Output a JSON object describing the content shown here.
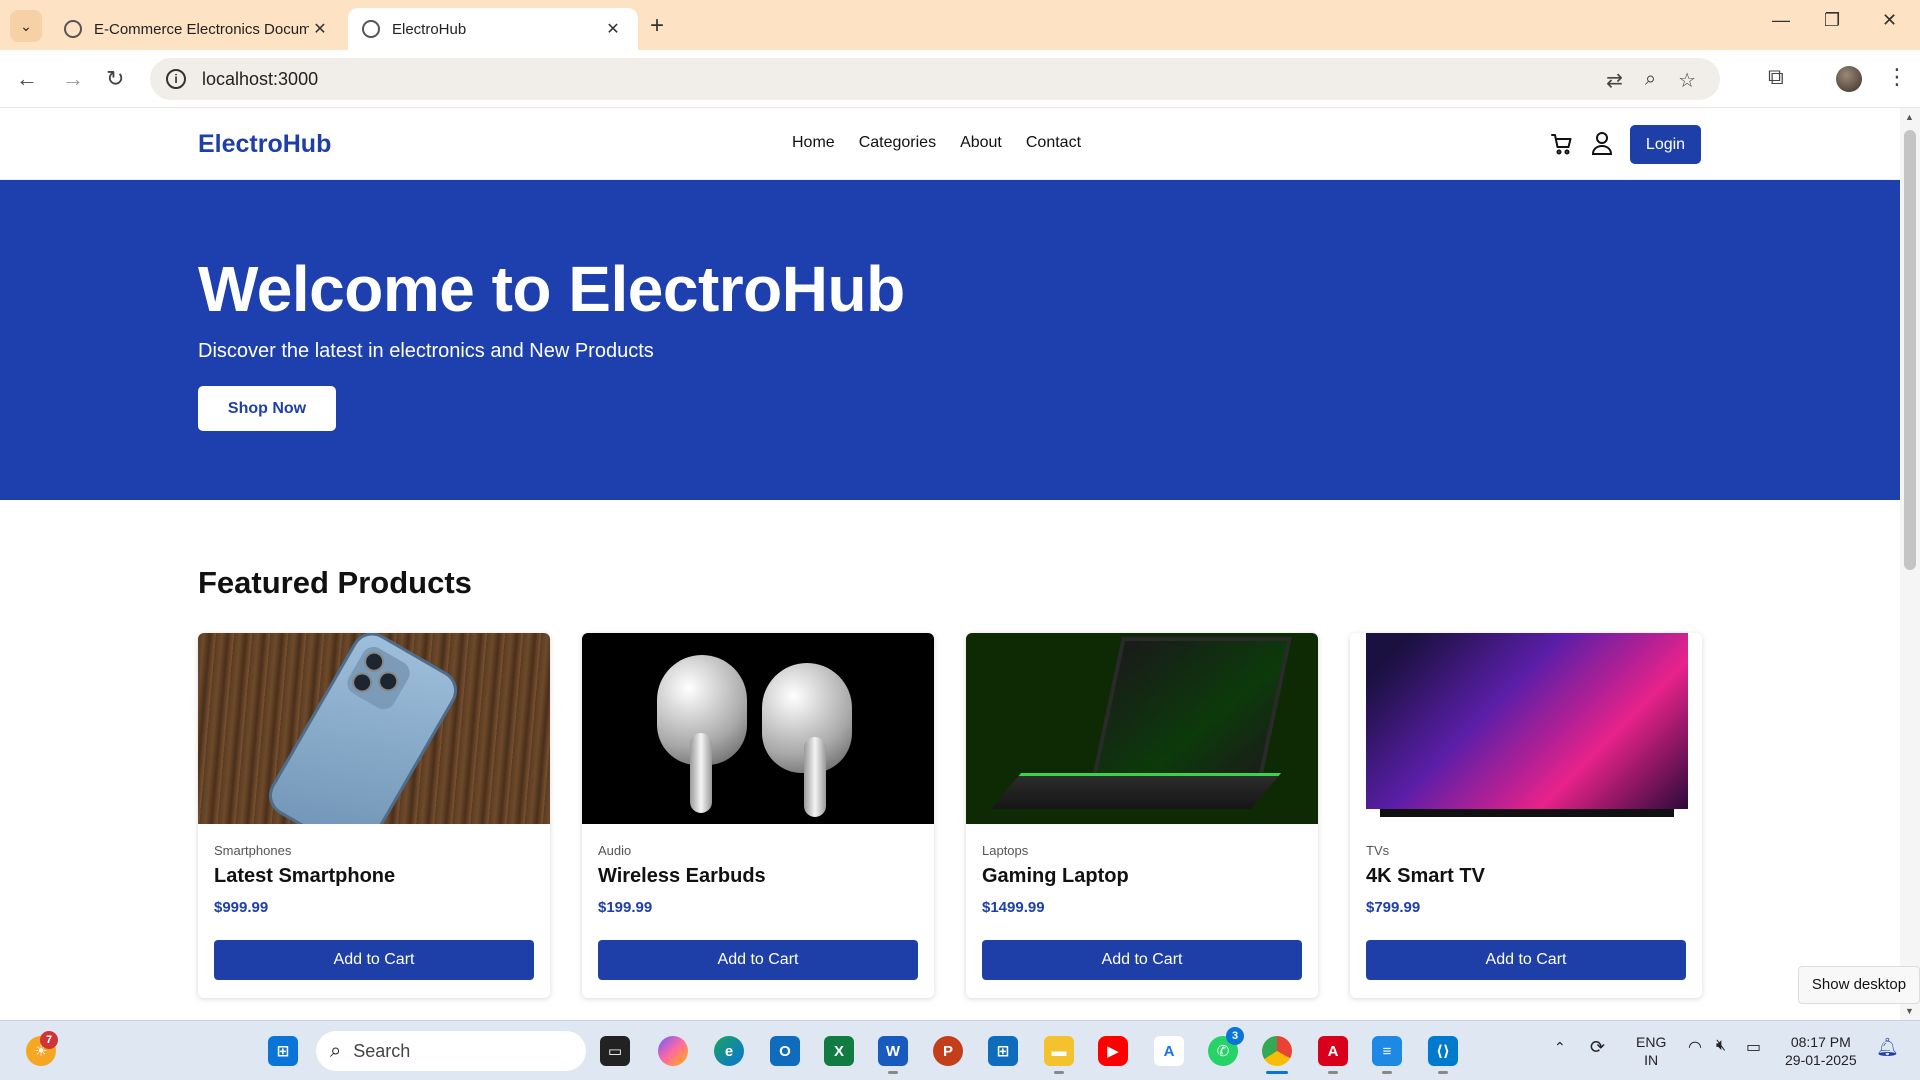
{
  "browser": {
    "tabs": [
      {
        "title": "E-Commerce Electronics Docum",
        "active": false
      },
      {
        "title": "ElectroHub",
        "active": true
      }
    ],
    "new_tab": "+",
    "url": "localhost:3000"
  },
  "site": {
    "logo": "ElectroHub",
    "menu": [
      "Home",
      "Categories",
      "About",
      "Contact"
    ],
    "login": "Login",
    "hero": {
      "title": "Welcome to ElectroHub",
      "subtitle": "Discover the latest in electronics and New Products",
      "cta": "Shop Now"
    },
    "featured_title": "Featured Products",
    "products": [
      {
        "category": "Smartphones",
        "name": "Latest Smartphone",
        "price": "$999.99",
        "button": "Add to Cart"
      },
      {
        "category": "Audio",
        "name": "Wireless Earbuds",
        "price": "$199.99",
        "button": "Add to Cart"
      },
      {
        "category": "Laptops",
        "name": "Gaming Laptop",
        "price": "$1499.99",
        "button": "Add to Cart"
      },
      {
        "category": "TVs",
        "name": "4K Smart TV",
        "price": "$799.99",
        "button": "Add to Cart"
      }
    ],
    "brand_color": "#1e40af"
  },
  "tooltip": "Show desktop",
  "taskbar": {
    "search_placeholder": "Search",
    "weather_badge": "7",
    "whatsapp_badge": "3",
    "lang_line1": "ENG",
    "lang_line2": "IN",
    "time": "08:17 PM",
    "date": "29-01-2025"
  }
}
